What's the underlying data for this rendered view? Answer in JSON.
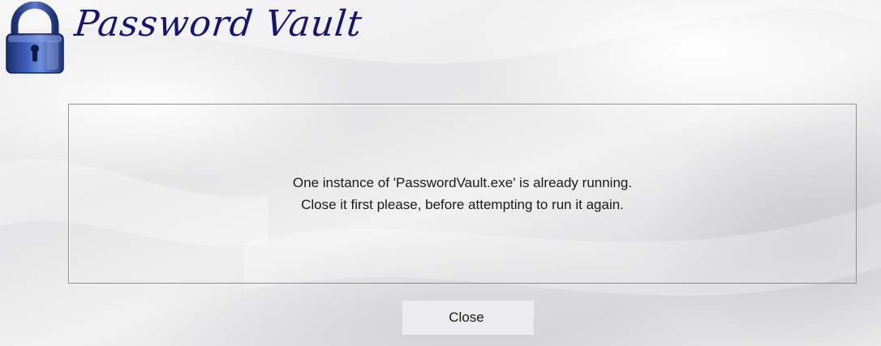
{
  "app": {
    "title": "Password Vault",
    "logo_icon": "padlock-icon"
  },
  "dialog": {
    "message_line_1": "One instance of 'PasswordVault.exe' is already running.",
    "message_line_2": "Close it first please, before attempting to run it again.",
    "close_label": "Close"
  },
  "colors": {
    "title": "#16166e",
    "padlock_body": "#2e4fa8",
    "background": "#e8e8ea"
  }
}
